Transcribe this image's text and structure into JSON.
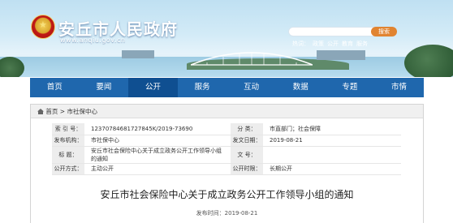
{
  "header": {
    "site_title": "安丘市人民政府",
    "site_url": "www.anqiu.gov.cn",
    "search_button": "搜索",
    "hot_label": "热词：",
    "hot_words": [
      "政策",
      "公开",
      "教育",
      "服务"
    ]
  },
  "nav": {
    "items": [
      "首页",
      "要闻",
      "公开",
      "服务",
      "互动",
      "数据",
      "专题",
      "市情"
    ],
    "active": "公开"
  },
  "breadcrumb": {
    "home": "首页",
    "separator": ">",
    "current": "市社保中心"
  },
  "meta": {
    "index_label": "索  引  号：",
    "index_value": "12370784681727845K/2019-73690",
    "category_label": "分    类：",
    "category_value": "市直部门；社会保障",
    "issuer_label": "发布机构：",
    "issuer_value": "市社保中心",
    "date_label": "发文日期：",
    "date_value": "2019-08-21",
    "title_label": "标      题：",
    "title_value": "安丘市社会保险中心关于成立政务公开工作领导小组的通知",
    "docno_label": "文    号：",
    "docno_value": "",
    "method_label": "公开方式：",
    "method_value": "主动公开",
    "period_label": "公开时限：",
    "period_value": "长期公开"
  },
  "article": {
    "title": "安丘市社会保险中心关于成立政务公开工作领导小组的通知",
    "publish_label": "发布时间：",
    "publish_date": "2019-08-21"
  },
  "colors": {
    "nav_bg": "#1f67ad",
    "nav_active": "#0f4f91",
    "search_button": "#e18431"
  }
}
